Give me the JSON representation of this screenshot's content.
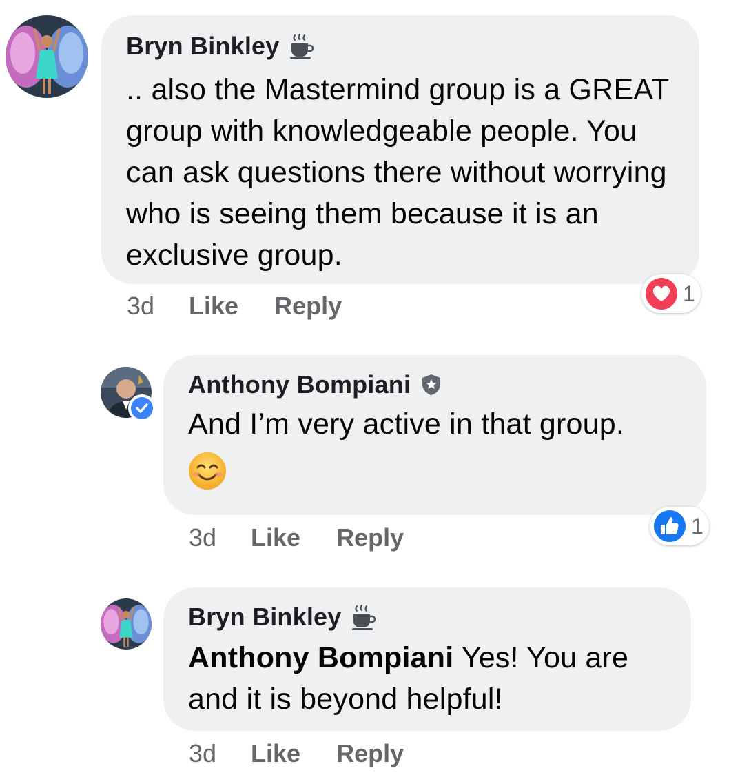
{
  "comments": [
    {
      "author": "Bryn Binkley",
      "author_badge": "coffee-cup-icon",
      "text": ".. also the Mastermind group is a GREAT group with knowledgeable people. You can ask questions there without worrying who is seeing them because it is an exclusive group.",
      "time": "3d",
      "like_label": "Like",
      "reply_label": "Reply",
      "reaction": {
        "type": "love",
        "count": "1",
        "color": "#f33e58"
      }
    },
    {
      "author": "Anthony Bompiani",
      "author_badge": "admin-shield-icon",
      "verified": true,
      "text": "And I’m very active in that group.",
      "emoji": "smiling-face-icon",
      "time": "3d",
      "like_label": "Like",
      "reply_label": "Reply",
      "reaction": {
        "type": "like",
        "count": "1",
        "color": "#1877f2"
      }
    },
    {
      "author": "Bryn Binkley",
      "author_badge": "coffee-cup-icon",
      "mention": "Anthony Bompiani",
      "text": "Yes! You are and it is beyond helpful!",
      "time": "3d",
      "like_label": "Like",
      "reply_label": "Reply"
    }
  ],
  "colors": {
    "bubble": "#eff0f2",
    "meta_text": "#65676b",
    "body_text": "#050505",
    "verified": "#3b82f6"
  }
}
